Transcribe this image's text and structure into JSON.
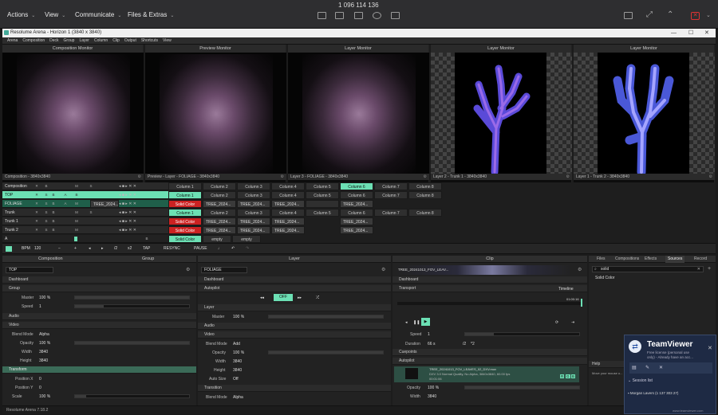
{
  "teamviewer_bar": {
    "menus": [
      "Actions",
      "View",
      "Communicate",
      "Files & Extras"
    ],
    "session_id": "1 096 114 136"
  },
  "window": {
    "title": "Resolume Arena - Horizon 1 (3840 x 3840)",
    "menu": [
      "Arena",
      "Composition",
      "Deck",
      "Group",
      "Layer",
      "Column",
      "Clip",
      "Output",
      "Shortcuts",
      "View"
    ]
  },
  "monitors": [
    {
      "title": "Composition Monitor",
      "footer": "Composition - 3840x3840"
    },
    {
      "title": "Preview Monitor",
      "footer": "Preview - Layer - FOLIAGE - 3840x3840"
    },
    {
      "title": "Layer Monitor",
      "footer": "Layer 3 - FOLIAGE - 3840x3840"
    },
    {
      "title": "Layer Monitor",
      "footer": "Layer 2 - Trunk 1 - 3840x3840"
    },
    {
      "title": "Layer Monitor",
      "footer": "Layer 1 - Trunk 2 - 3840x3840"
    }
  ],
  "deck": {
    "layer_rows": [
      "Composition",
      "TOP",
      "FOLIAGE",
      "Trunk",
      "Trunk 1",
      "Trunk 2"
    ],
    "columns": [
      "Column 1",
      "Column 2",
      "Column 3",
      "Column 4",
      "Column 5",
      "Column 6",
      "Column 7",
      "Column 8"
    ],
    "clip_short": "TREE_2024...",
    "solid_color": "Solid Color",
    "empty": "empty",
    "a_label": "A"
  },
  "transport": {
    "bpm_label": "BPM",
    "bpm": "120",
    "div": "/2",
    "mul": "x2",
    "tap": "TAP",
    "resync": "RESYNC",
    "pause": "PAUSE"
  },
  "composition_panel": {
    "tab1": "Composition",
    "tab2": "Group",
    "name": "TOP",
    "sections": {
      "dashboard": "Dashboard",
      "group": "Group",
      "audio": "Audio",
      "video": "Video",
      "transform": "Transform"
    },
    "master_label": "Master",
    "master_val": "100 %",
    "speed_label": "Speed",
    "speed_val": "1",
    "blend_label": "Blend Mode",
    "blend_val": "Alpha",
    "opacity_label": "Opacity",
    "opacity_val": "100 %",
    "width_label": "Width",
    "width_val": "3840",
    "height_label": "Height",
    "height_val": "3840",
    "posx_label": "Position X",
    "posx_val": "0",
    "posy_label": "Position Y",
    "posy_val": "0",
    "scale_label": "Scale",
    "scale_val": "100 %"
  },
  "layer_panel": {
    "title": "Layer",
    "name": "FOLIAGE",
    "sections": {
      "dashboard": "Dashboard",
      "autopilot": "Autopilot",
      "layer": "Layer",
      "audio": "Audio",
      "video": "Video",
      "transition": "Transition"
    },
    "autopilot_state": "OFF",
    "master_label": "Master",
    "master_val": "100 %",
    "blend_label": "Blend Mode",
    "blend_val": "Add",
    "opacity_label": "Opacity",
    "opacity_val": "100 %",
    "width_label": "Width",
    "width_val": "3840",
    "height_label": "Height",
    "height_val": "3840",
    "autosize_label": "Auto Size",
    "autosize_val": "Off",
    "tblend_label": "Blend Mode",
    "tblend_val": "Alpha"
  },
  "clip_panel": {
    "title": "Clip",
    "name": "TREE_20241013_FOV_LEAV...",
    "sections": {
      "dashboard": "Dashboard",
      "transport": "Transport",
      "cuepoints": "Cuepoints",
      "autopilot": "Autopilot"
    },
    "timeline": "Timeline",
    "time": "01:00:16",
    "speed_label": "Speed",
    "speed_val": "1",
    "duration_label": "Duration",
    "duration_val": "66 s",
    "div": "/2",
    "mul": "*2",
    "file_name": "TREE_20241013_FOV_LEAVES_02_DXV.mov",
    "file_info": "DXV 3.0 Normal Quality, No Alpha, 3840x3840, 60.00 fps",
    "file_dur": "00:01:06",
    "opacity_label": "Opacity",
    "opacity_val": "100 %",
    "width_label": "Width",
    "width_val": "3840",
    "rgb": [
      "R",
      "G",
      "B"
    ]
  },
  "browser_panel": {
    "tabs": [
      "Files",
      "Compositions",
      "Effects",
      "Sources",
      "Record"
    ],
    "active_tab": "Sources",
    "search": "solid",
    "result": "Solid Color",
    "help_title": "Help",
    "help_text": "Move your mouse o..."
  },
  "teamviewer_popup": {
    "brand": "TeamViewer",
    "line1": "Free license (personal use",
    "line2": "only) - Already have an acc...",
    "session_list": "Session list",
    "user": "Morgan Lavers (1 137 303 27)",
    "footer": "www.teamviewer.com"
  },
  "status_text": "Resolume Arena 7.18.2"
}
